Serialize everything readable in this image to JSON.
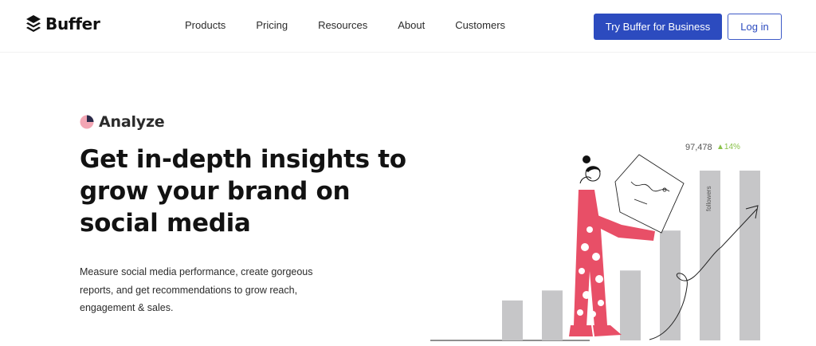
{
  "header": {
    "logo_text": "Buffer",
    "nav": [
      "Products",
      "Pricing",
      "Resources",
      "About",
      "Customers"
    ],
    "cta_primary": "Try Buffer for Business",
    "cta_secondary": "Log in"
  },
  "hero": {
    "eyebrow": "Analyze",
    "headline": "Get in-depth insights to grow your brand on social media",
    "subtext": "Measure social media performance, create gorgeous reports, and get recommendations to grow reach, engagement & sales."
  },
  "illustration": {
    "stat_value": "97,478",
    "stat_change": "▲14%",
    "bar_label": "followers",
    "bar_values": [
      4,
      5,
      7,
      11,
      17,
      17
    ],
    "icon": "analytics-pie-icon",
    "colors": {
      "accent": "#2c4bbf",
      "bars": "#c6c6c8",
      "figure": "#e84f67",
      "positive": "#8ac24a",
      "pie": "#f3a6b4"
    }
  }
}
